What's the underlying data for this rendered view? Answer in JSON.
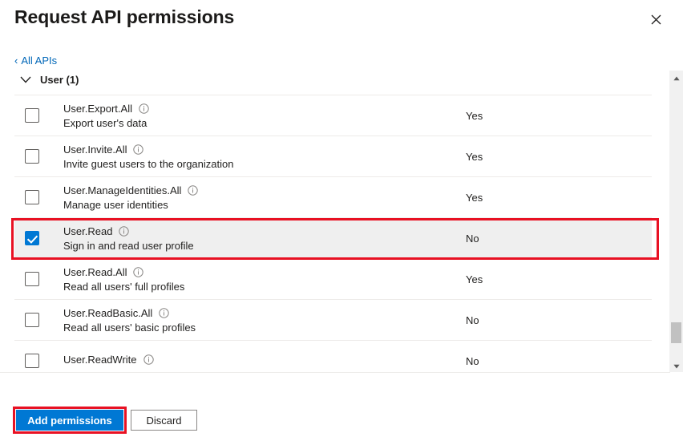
{
  "header": {
    "title": "Request API permissions",
    "close_icon": "close-icon"
  },
  "breadcrumb": {
    "back_chevron": "‹",
    "label": "All APIs"
  },
  "group": {
    "caret_icon": "chevron-down-icon",
    "label": "User (1)"
  },
  "permissions": [
    {
      "name": "User.Export.All",
      "description": "Export user's data",
      "admin_consent": "Yes",
      "checked": false,
      "selected": false
    },
    {
      "name": "User.Invite.All",
      "description": "Invite guest users to the organization",
      "admin_consent": "Yes",
      "checked": false,
      "selected": false
    },
    {
      "name": "User.ManageIdentities.All",
      "description": "Manage user identities",
      "admin_consent": "Yes",
      "checked": false,
      "selected": false
    },
    {
      "name": "User.Read",
      "description": "Sign in and read user profile",
      "admin_consent": "No",
      "checked": true,
      "selected": true
    },
    {
      "name": "User.Read.All",
      "description": "Read all users' full profiles",
      "admin_consent": "Yes",
      "checked": false,
      "selected": false
    },
    {
      "name": "User.ReadBasic.All",
      "description": "Read all users' basic profiles",
      "admin_consent": "No",
      "checked": false,
      "selected": false
    },
    {
      "name": "User.ReadWrite",
      "description": "",
      "admin_consent": "No",
      "checked": false,
      "selected": false
    }
  ],
  "footer": {
    "primary_label": "Add permissions",
    "secondary_label": "Discard"
  },
  "scrollbar": {
    "up_arrow_icon": "caret-up-icon",
    "down_arrow_icon": "caret-down-icon"
  },
  "annotations": {
    "accent_color": "#e81123",
    "primary_color": "#0078d4",
    "link_color": "#0067b8",
    "selected_row_bg": "#efefef"
  }
}
